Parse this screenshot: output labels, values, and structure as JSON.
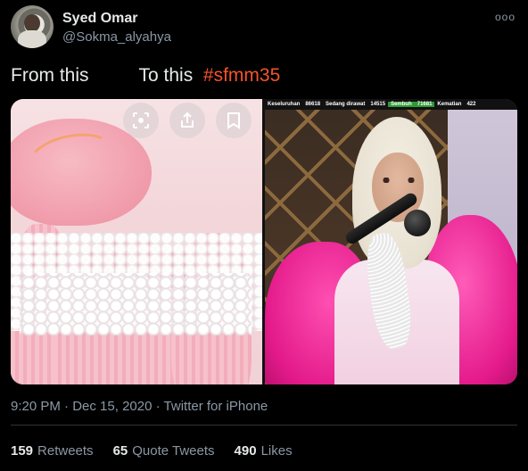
{
  "author": {
    "name": "Syed Omar",
    "handle": "@Sokma_alyahya"
  },
  "tweet": {
    "text_part1": "From this",
    "text_part2": "To this",
    "hashtag": "#sfmm35"
  },
  "media": {
    "left_image_controls": [
      "lens-icon",
      "share-icon",
      "bookmark-icon"
    ],
    "ticker": {
      "label_total": "Keseluruhan",
      "total": "86618",
      "label_treated": "Sedang dirawat",
      "treated": "14515",
      "label_recovered": "Sembuh",
      "recovered": "71681",
      "label_deaths": "Kematian",
      "deaths": "422"
    }
  },
  "meta": {
    "time": "9:20 PM",
    "separator": "·",
    "date": "Dec 15, 2020",
    "source": "Twitter for iPhone"
  },
  "stats": {
    "retweets_count": "159",
    "retweets_label": "Retweets",
    "quote_count": "65",
    "quote_label": "Quote Tweets",
    "likes_count": "490",
    "likes_label": "Likes"
  },
  "colors": {
    "background": "#000000",
    "hashtag": "#f5532a",
    "secondary_text": "#8b98a5"
  }
}
